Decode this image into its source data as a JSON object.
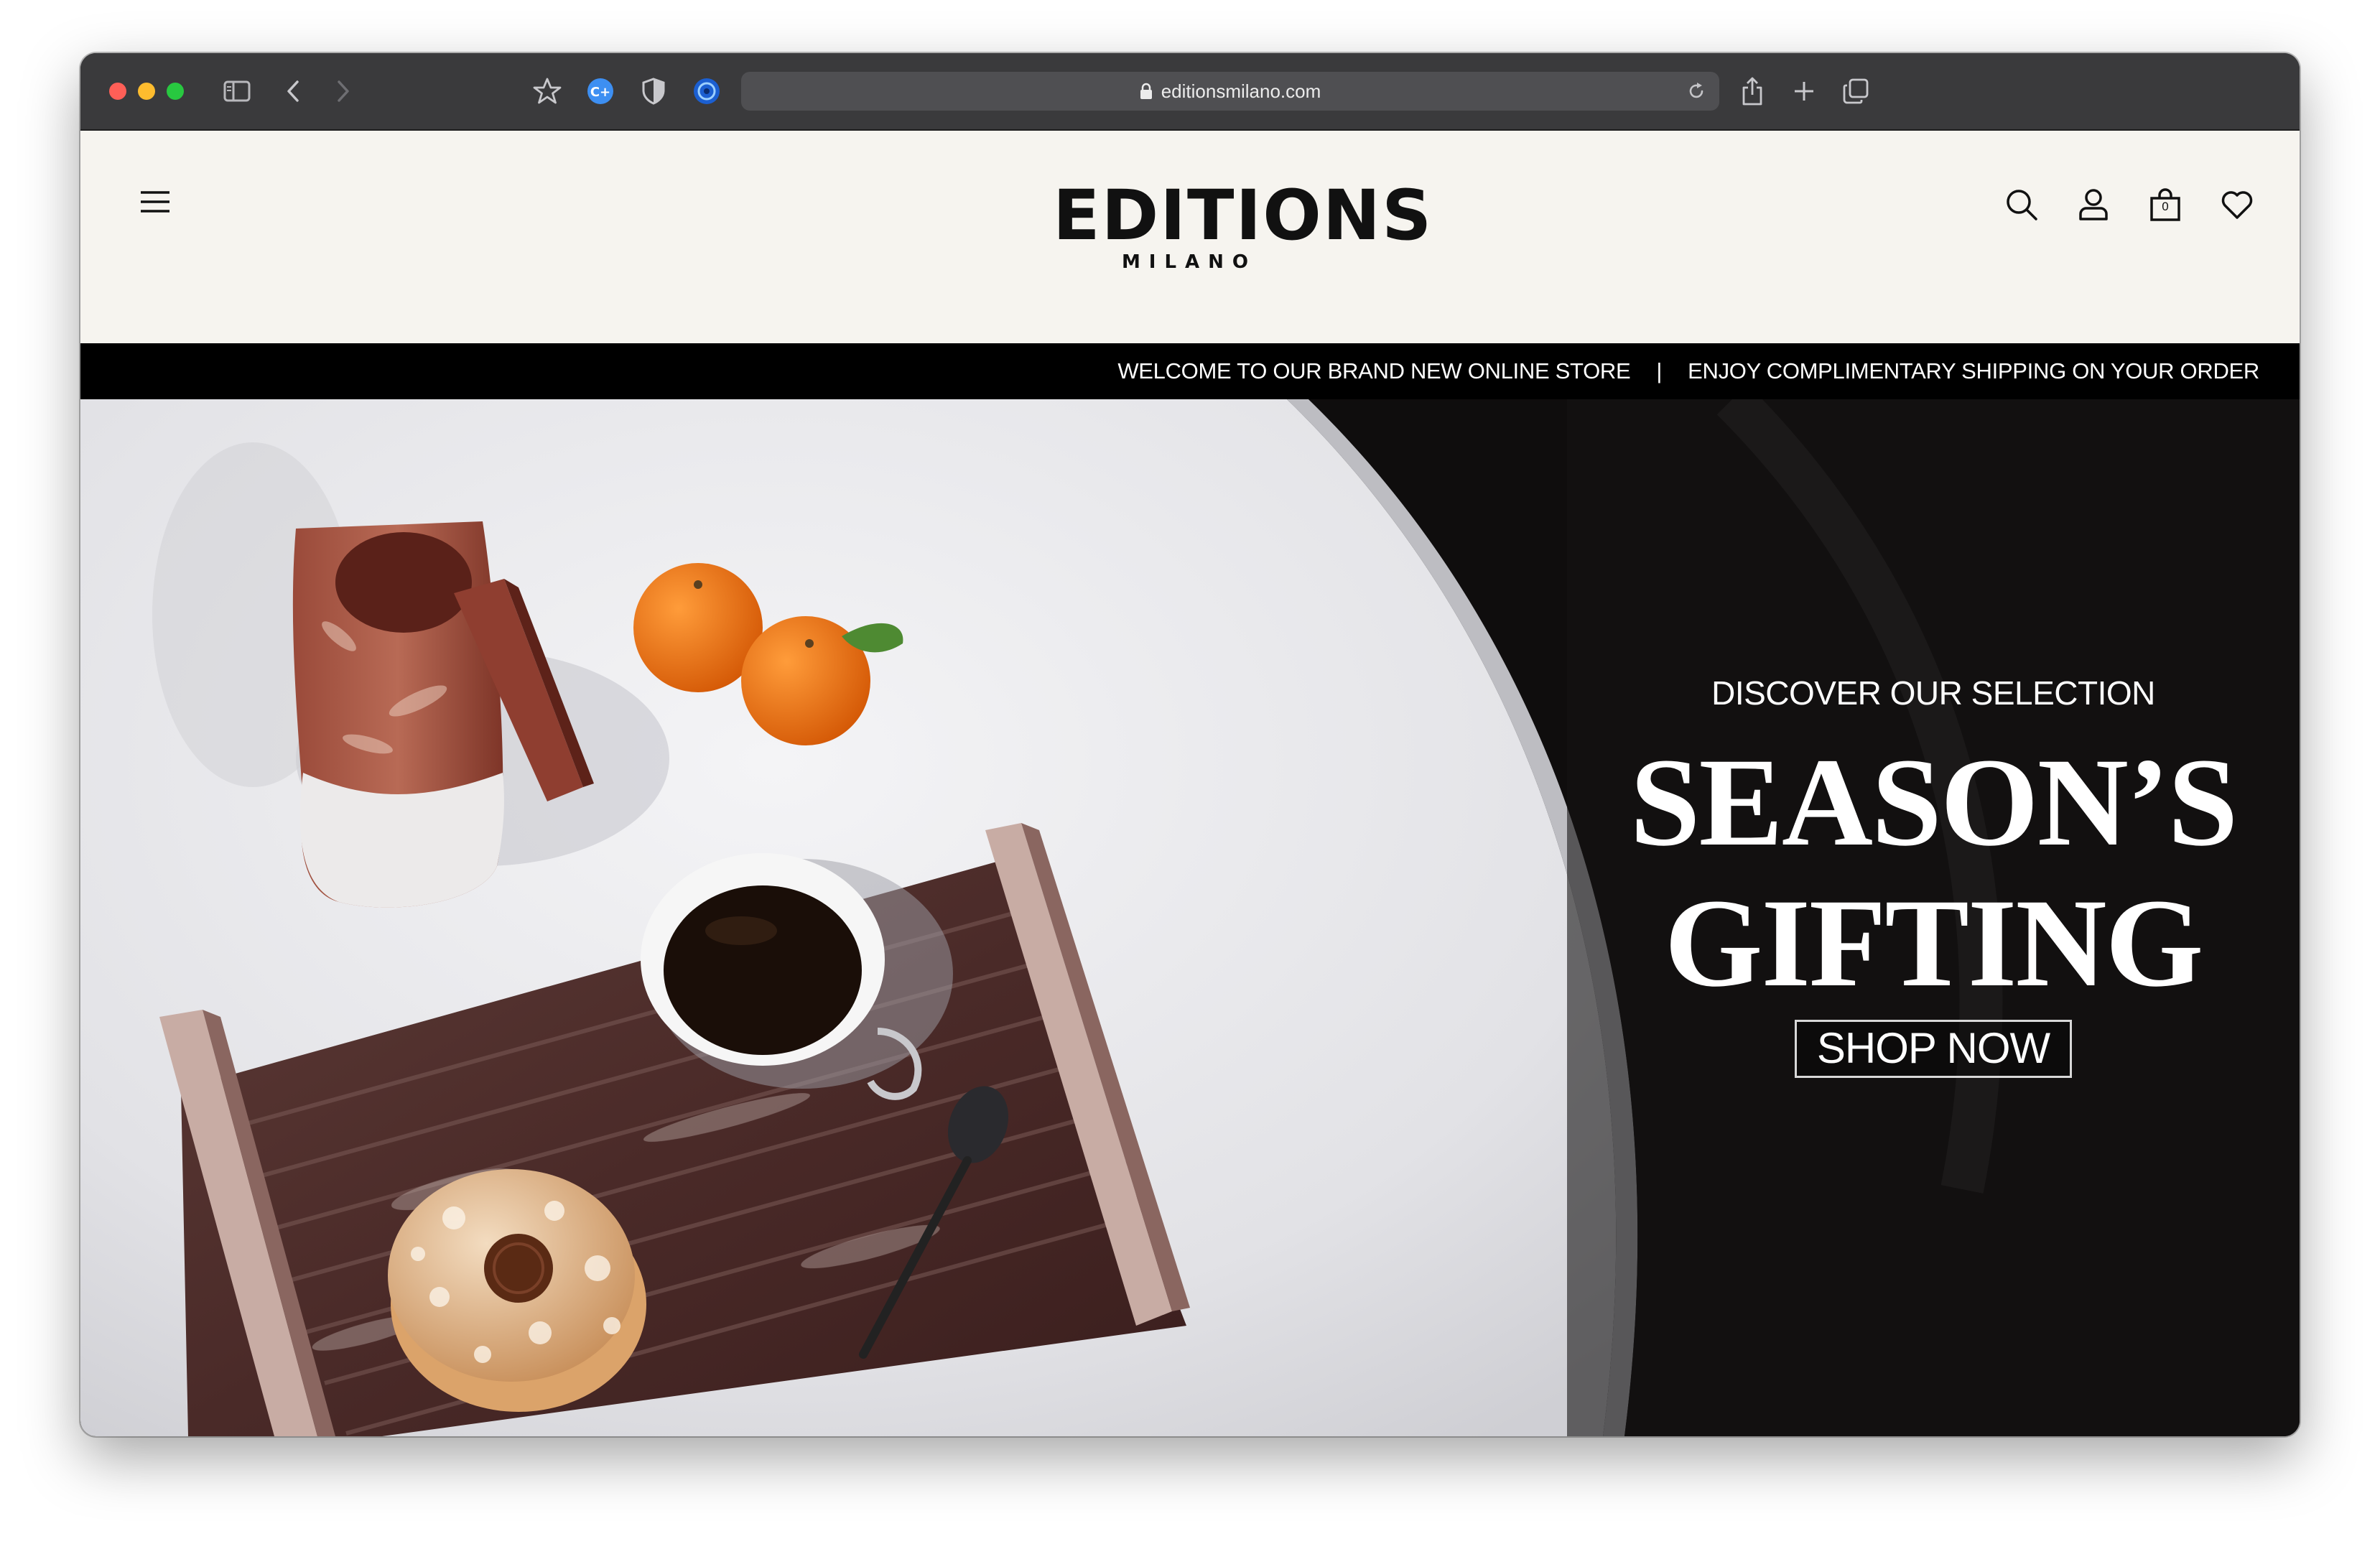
{
  "browser": {
    "url": "editionsmilano.com",
    "icons": [
      "sidebar-icon",
      "back-icon",
      "forward-icon",
      "bookmark-star-icon",
      "extension-c-icon",
      "shield-icon",
      "extension-globe-icon",
      "lock-icon",
      "reload-icon",
      "share-icon",
      "new-tab-icon",
      "tabs-overview-icon"
    ]
  },
  "header": {
    "logo_main": "EDITIONS",
    "logo_sub": "MILANO",
    "cart_count": "0",
    "icons": [
      "menu-icon",
      "search-icon",
      "account-icon",
      "cart-icon",
      "wishlist-heart-icon"
    ]
  },
  "announcement": {
    "left": "WELCOME TO OUR BRAND NEW ONLINE STORE",
    "separator": "|",
    "right": "ENJOY COMPLIMENTARY SHIPPING ON YOUR ORDER"
  },
  "hero": {
    "eyebrow": "DISCOVER OUR SELECTION",
    "title_line1": "SEASON’S",
    "title_line2": "GIFTING",
    "cta": "SHOP NOW"
  },
  "colors": {
    "toolbar": "#3a3a3c",
    "header_bg": "#f6f4ef",
    "announce_bg": "#000000",
    "hero_dark": "#0e0d0d",
    "marble_red": "#7a3a30"
  }
}
